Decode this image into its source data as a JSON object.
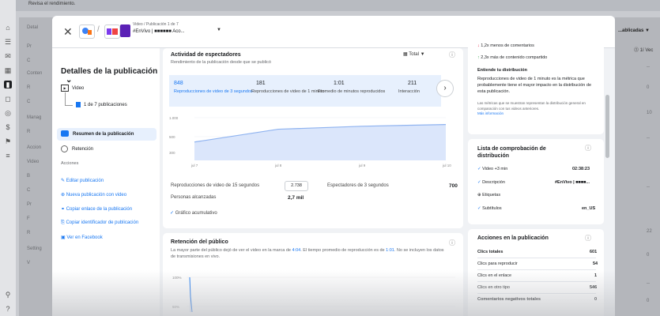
{
  "app": {
    "top_text": "Revisa el rendimiento."
  },
  "background": {
    "right_header": "...ablicadas ▼",
    "right_header2": "⓵ 1í  Vec",
    "right_values": [
      "--",
      "0",
      "10",
      "--",
      "--",
      "22",
      "0",
      "--",
      "0"
    ],
    "left_labels": [
      "Detal",
      "Pr",
      "C",
      "Conten",
      "R",
      "C",
      "Manag",
      "R",
      "Accion",
      "Video",
      "B",
      "C",
      "Pr",
      "F",
      "R",
      "Setting",
      "V"
    ]
  },
  "header": {
    "close": "✕",
    "page_name": "Video / Publicación 1 de 7",
    "page_sub": "#EnVivo | ■■■■■■ Aco...",
    "dropdown": "▼"
  },
  "sidebar": {
    "title": "Detalles de la publicación",
    "title_chev": "⌄",
    "type": "Video",
    "pub_count": "1 de 7 publicaciones",
    "nav": [
      "Resumen de la publicación",
      "Retención"
    ],
    "actions_title": "Acciones",
    "actions": [
      "Editar publicación",
      "Nueva publicación con video",
      "Copiar enlace de la publicación",
      "Copiar identificador de publicación",
      "Ver en Facebook"
    ]
  },
  "activity": {
    "title": "Actividad de espectadores",
    "subtitle": "Rendimiento de la publicación desde que se publicó",
    "total_label": "Total ▼",
    "metrics": [
      {
        "value": "848",
        "label": "Reproducciones de video de 3 segundos"
      },
      {
        "value": "181",
        "label": "Reproducciones de video de 1 minuto"
      },
      {
        "value": "1:01",
        "label": "Promedio de minutos reproducidos"
      },
      {
        "value": "211",
        "label": "Interacción"
      }
    ],
    "next": "›",
    "y_ticks": [
      "1.000",
      "500",
      "300"
    ],
    "x_ticks": [
      "jul 7",
      "jul 8",
      "jul 9",
      "jul 10"
    ],
    "stats": {
      "views15_label": "Reproducciones de video de 15 segundos",
      "views15_value": "2.738",
      "viewers3_label": "Espectadores de 3 segundos",
      "viewers3_value": "700",
      "reach_label": "Personas alcanzadas",
      "reach_value": "2,7 mil"
    },
    "cumulative": "Gráfico acumulativo"
  },
  "chart_data": {
    "type": "area",
    "x": [
      "jul 7",
      "jul 8",
      "jul 9",
      "jul 10"
    ],
    "values": [
      430,
      730,
      800,
      840
    ],
    "yticks": [
      "1.000",
      "500",
      "300"
    ],
    "ylim": [
      0,
      1000
    ]
  },
  "retention": {
    "title": "Retención del público",
    "desc1": "La mayor parte del público dejó de ver el video en la marca de",
    "mark": "4:04",
    "desc2": ". El tiempo promedio de reproducción es de",
    "avg": "1:01",
    "desc3": ". No se incluyen los datos de transmisiones en vivo.",
    "y_ticks": [
      "100%",
      "50%"
    ]
  },
  "insights": {
    "line1": "1,2x menos de comentarios",
    "line2": "2,3x más de contenido compartido",
    "understand_title": "Entiende tu distribución",
    "understand_text": "Reproducciones de video de 1 minuto es la métrica que probablemente tiene el mayor impacto en la distribución de esta publicación.",
    "note": "Las métricas que se muestran representan la distribución general en comparación con tus videos anteriores.",
    "more": "Más información"
  },
  "checklist": {
    "title": "Lista de comprobación de distribución",
    "items": [
      {
        "label": "Video +3 min",
        "value": "02:38:23"
      },
      {
        "label": "Descripción",
        "value": "#EnVivo | ■■■■..."
      },
      {
        "label": "Etiquetas",
        "value": ""
      },
      {
        "label": "Subtítulos",
        "value": "en_US"
      }
    ]
  },
  "actions_card": {
    "title": "Acciones en la publicación",
    "rows": [
      {
        "label": "Clics totales",
        "value": "601"
      },
      {
        "label": "Clics para reproducir",
        "value": "54"
      },
      {
        "label": "Clics en el enlace",
        "value": "1"
      },
      {
        "label": "Clics en otro tipo",
        "value": "546"
      },
      {
        "label": "Comentarios negativos totales",
        "value": "0"
      }
    ]
  },
  "colors": {
    "accent": "#1877f2",
    "chart_fill": "#dbe6fb",
    "chart_line": "#8fb3f0"
  }
}
